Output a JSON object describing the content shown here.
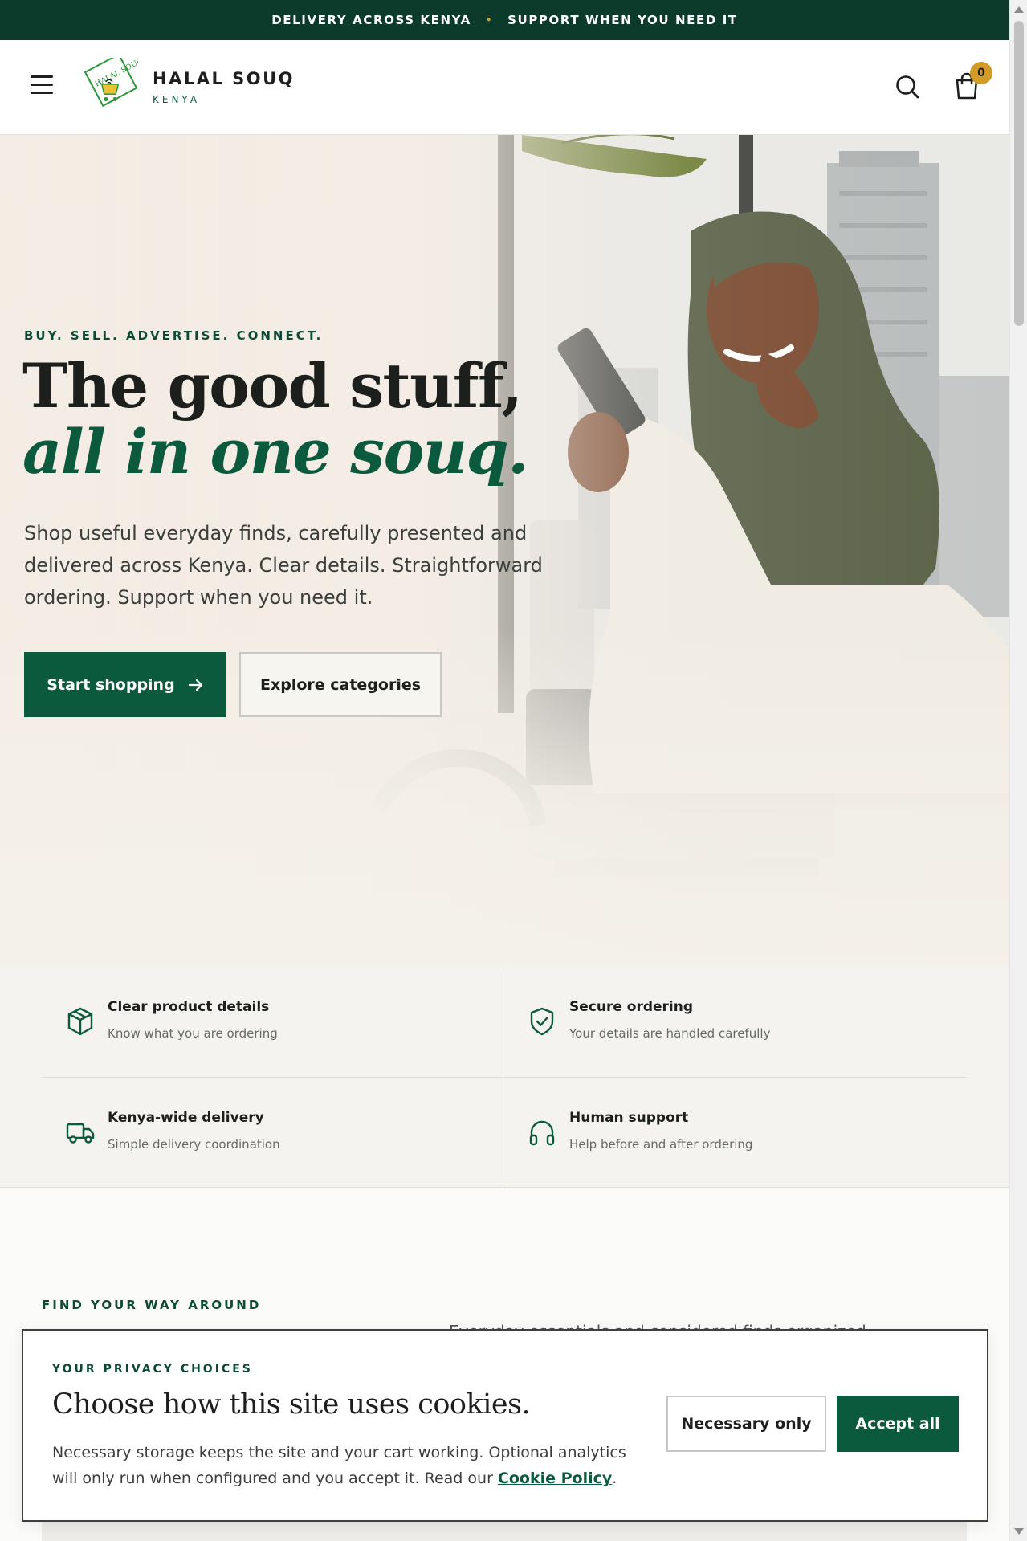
{
  "announcement": {
    "left": "DELIVERY ACROSS KENYA",
    "separator": "•",
    "right": "SUPPORT WHEN YOU NEED IT"
  },
  "header": {
    "brand_name": "HALAL SOUQ",
    "brand_country": "KENYA",
    "logo_text": "HALAL SOUQ",
    "cart_count": "0",
    "icons": [
      "menu-icon",
      "search-icon",
      "shopping-bag-icon"
    ]
  },
  "hero": {
    "eyebrow": "BUY. SELL. ADVERTISE. CONNECT.",
    "headline_line1": "The good stuff,",
    "headline_line2": "all in one souq.",
    "lede": "Shop useful everyday finds, carefully presented and delivered across Kenya. Clear details. Straightforward ordering. Support when you need it.",
    "primary_cta": "Start shopping",
    "secondary_cta": "Explore categories"
  },
  "features": [
    {
      "icon": "package-icon",
      "title": "Clear product details",
      "desc": "Know what you are ordering"
    },
    {
      "icon": "shield-check-icon",
      "title": "Secure ordering",
      "desc": "Your details are handled carefully"
    },
    {
      "icon": "truck-icon",
      "title": "Kenya-wide delivery",
      "desc": "Simple delivery coordination"
    },
    {
      "icon": "headphones-icon",
      "title": "Human support",
      "desc": "Help before and after ordering"
    }
  ],
  "section": {
    "eyebrow": "FIND YOUR WAY AROUND",
    "desc_partial": "Everyday essentials and considered finds organized"
  },
  "cookie": {
    "eyebrow": "YOUR PRIVACY CHOICES",
    "title": "Choose how this site uses cookies.",
    "body": "Necessary storage keeps the site and your cart working. Optional analytics will only run when configured and you accept it. Read our ",
    "link": "Cookie Policy",
    "body_end": ".",
    "necessary_btn": "Necessary only",
    "accept_btn": "Accept all"
  },
  "colors": {
    "brand_green": "#0c5a3e",
    "dark_green": "#0c3b2b",
    "gold": "#d19b25",
    "cream": "#f5f3ef"
  }
}
